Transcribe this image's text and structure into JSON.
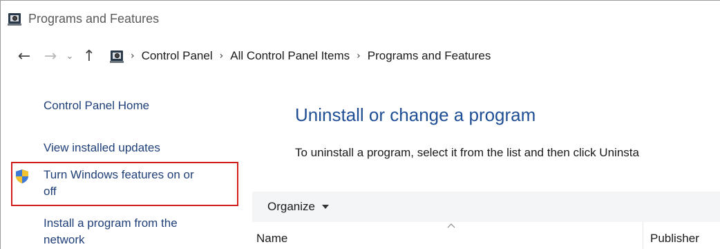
{
  "window": {
    "title": "Programs and Features"
  },
  "address": {
    "icons": {
      "back": "back-arrow-icon",
      "forward": "forward-arrow-icon",
      "recent": "chevron-down-icon",
      "up": "up-arrow-icon"
    },
    "breadcrumbs": [
      "Control Panel",
      "All Control Panel Items",
      "Programs and Features"
    ]
  },
  "sidebar": {
    "home": "Control Panel Home",
    "updates": "View installed updates",
    "features_line1": "Turn Windows features on or",
    "features_line2": "off",
    "install_line1": "Install a program from the",
    "install_line2": "network"
  },
  "main": {
    "title": "Uninstall or change a program",
    "description": "To uninstall a program, select it from the list and then click Uninsta",
    "toolbar": {
      "organize": "Organize"
    },
    "columns": {
      "name": "Name",
      "publisher": "Publisher"
    }
  },
  "colors": {
    "link": "#1f3f78",
    "heading": "#1e4e94",
    "highlight": "#d11c1c",
    "toolbar_bg": "#f4f5f7"
  }
}
